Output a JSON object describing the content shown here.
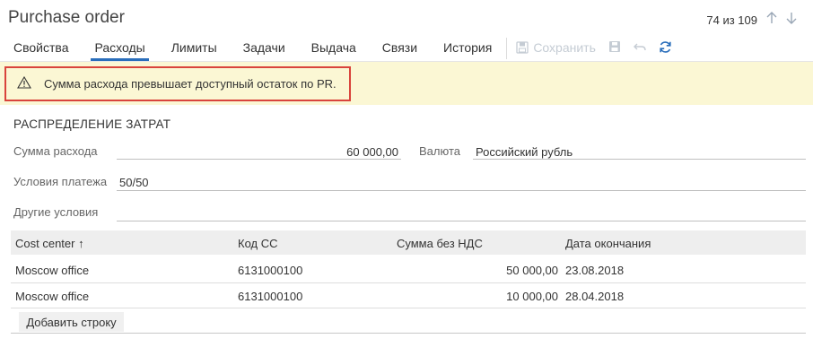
{
  "header": {
    "title": "Purchase order",
    "record_position": "74 из 109"
  },
  "tabs": [
    {
      "label": "Свойства"
    },
    {
      "label": "Расходы"
    },
    {
      "label": "Лимиты"
    },
    {
      "label": "Задачи"
    },
    {
      "label": "Выдача"
    },
    {
      "label": "Связи"
    },
    {
      "label": "История"
    }
  ],
  "toolbar": {
    "save_label": "Сохранить"
  },
  "warning": {
    "text": "Сумма расхода превышает доступный остаток по PR."
  },
  "section": {
    "title": "РАСПРЕДЕЛЕНИЕ ЗАТРАТ"
  },
  "form": {
    "amount_label": "Сумма расхода",
    "amount_value": "60 000,00",
    "currency_label": "Валюта",
    "currency_value": "Российский рубль",
    "payment_terms_label": "Условия платежа",
    "payment_terms_value": "50/50",
    "other_terms_label": "Другие условия",
    "other_terms_value": ""
  },
  "grid": {
    "columns": [
      "Cost center ↑",
      "Код СС",
      "Сумма без НДС",
      "Дата окончания"
    ],
    "rows": [
      [
        "Moscow office",
        "6131000100",
        "50 000,00",
        "23.08.2018"
      ],
      [
        "Moscow office",
        "6131000100",
        "10 000,00",
        "28.04.2018"
      ]
    ],
    "add_row_label": "Добавить строку"
  },
  "colors": {
    "accent": "#2a6ebb",
    "warning_bg": "#fbf7d4",
    "warning_border": "#d9443c"
  }
}
